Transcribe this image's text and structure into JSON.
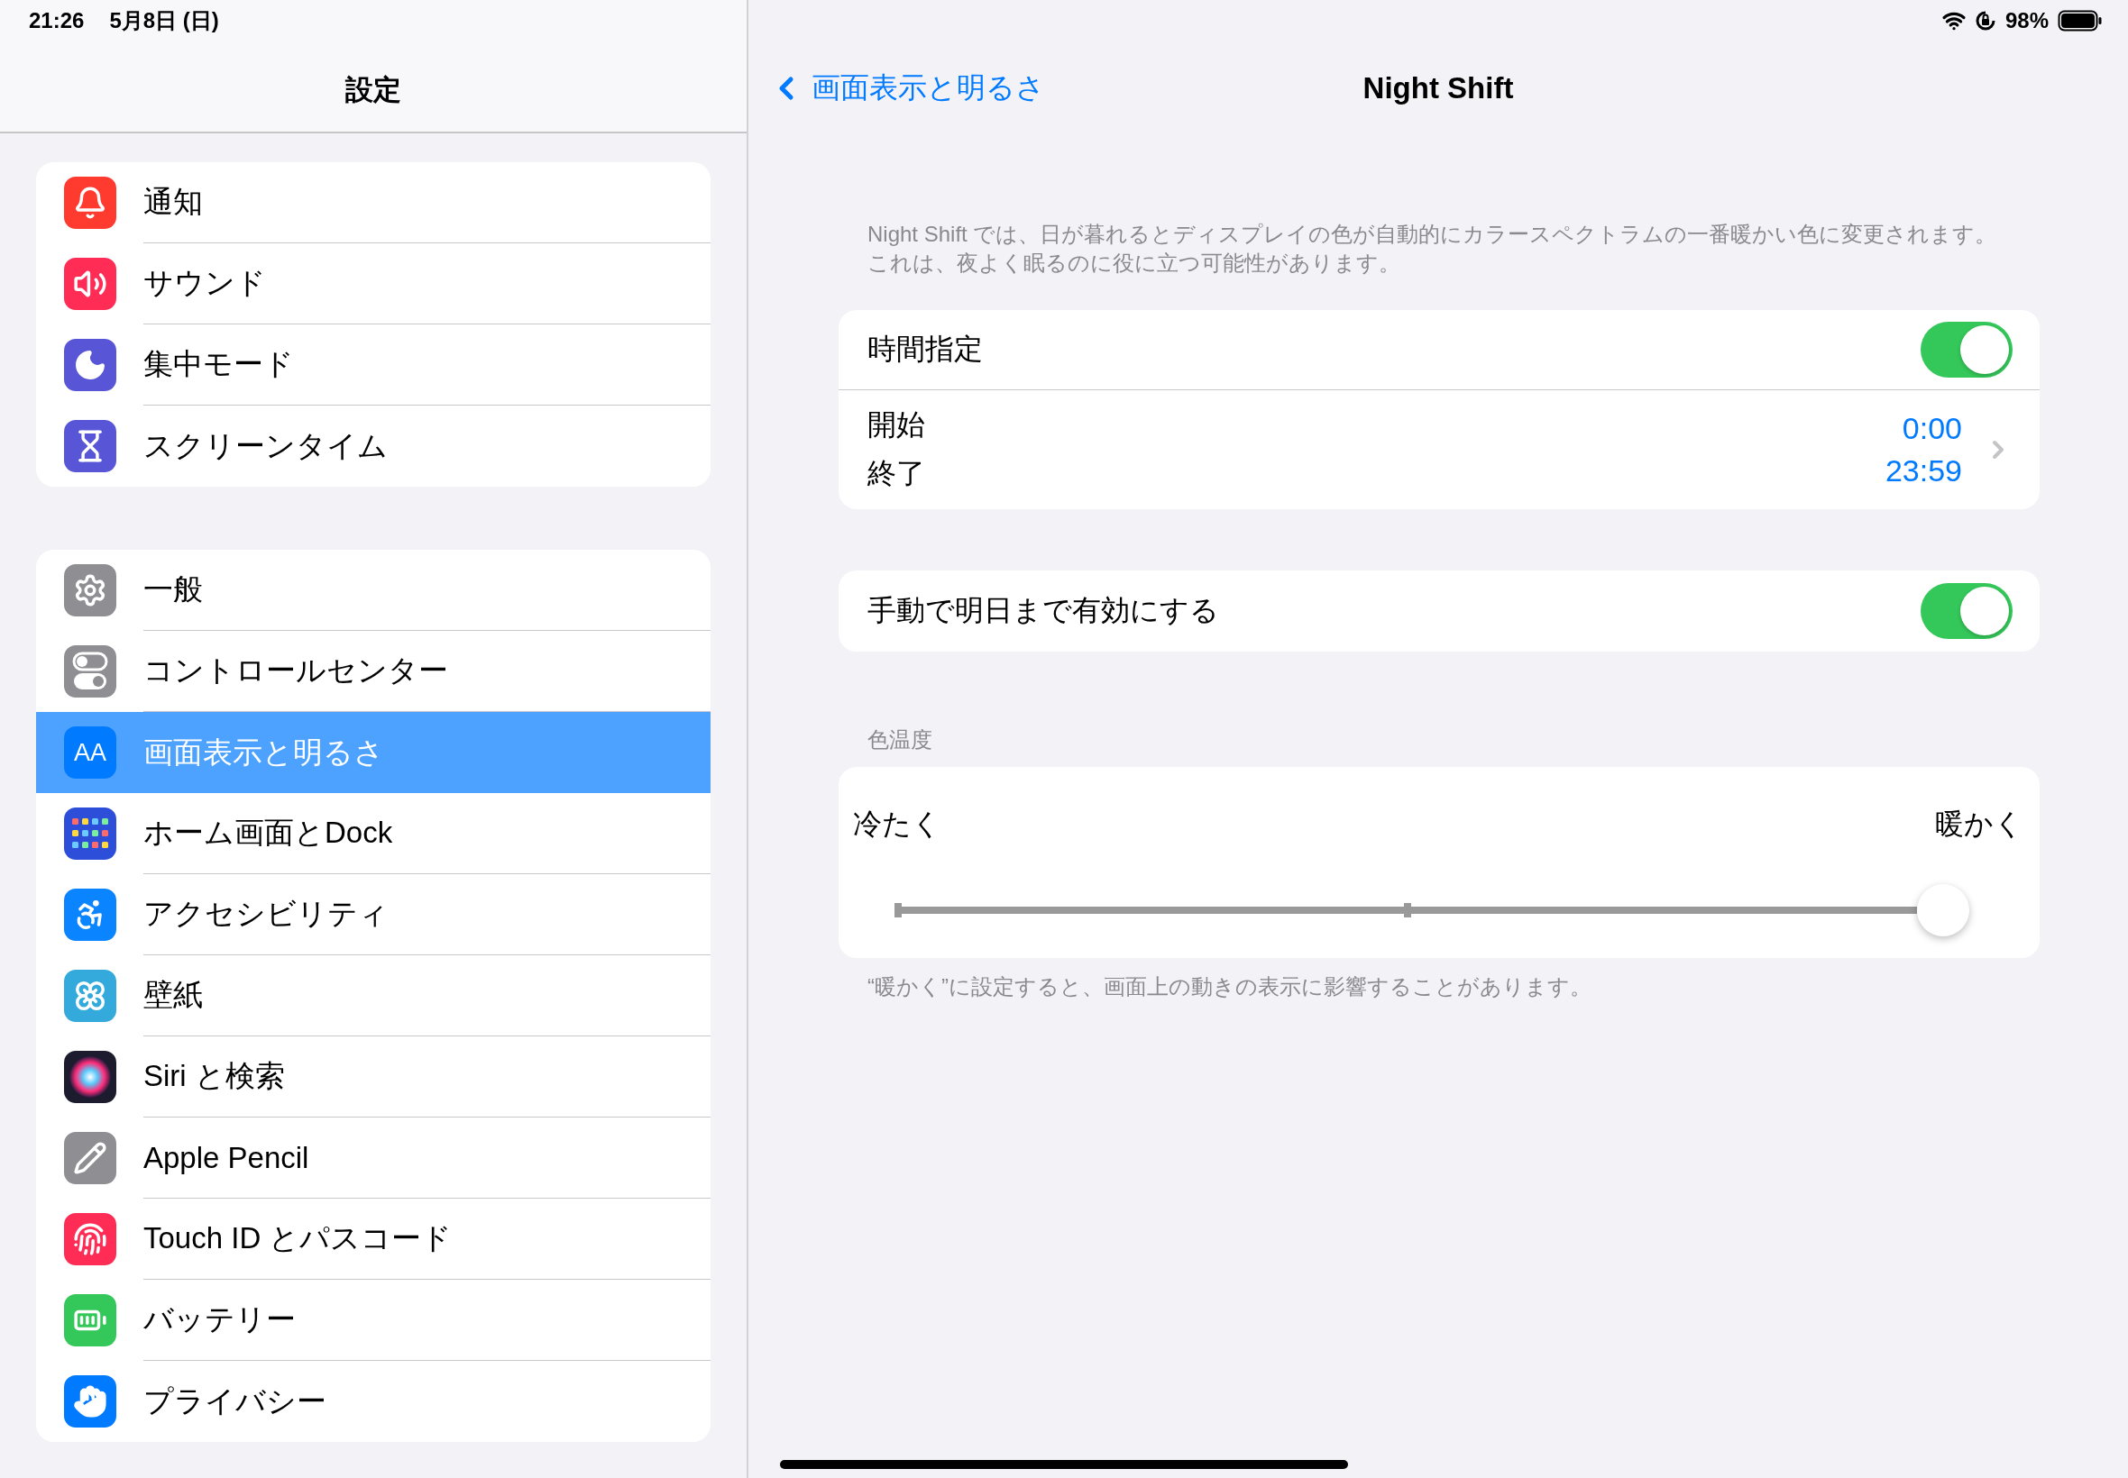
{
  "status_bar": {
    "time": "21:26",
    "date": "5月8日 (日)",
    "battery": "98%"
  },
  "sidebar": {
    "title": "設定",
    "groups": [
      {
        "items": [
          {
            "label": "通知",
            "color": "#ff3b30",
            "selected": false
          },
          {
            "label": "サウンド",
            "color": "#ff2d55",
            "selected": false
          },
          {
            "label": "集中モード",
            "color": "#5856d6",
            "selected": false
          },
          {
            "label": "スクリーンタイム",
            "color": "#5856d6",
            "selected": false
          }
        ]
      },
      {
        "items": [
          {
            "label": "一般",
            "color": "#8e8e93",
            "selected": false
          },
          {
            "label": "コントロールセンター",
            "color": "#8e8e93",
            "selected": false
          },
          {
            "label": "画面表示と明るさ",
            "color": "#007aff",
            "selected": true,
            "icon_label": "AA"
          },
          {
            "label": "ホーム画面とDock",
            "color": "#2c4ed8",
            "selected": false
          },
          {
            "label": "アクセシビリティ",
            "color": "#0a84ff",
            "selected": false
          },
          {
            "label": "壁紙",
            "color": "#34aadc",
            "selected": false
          },
          {
            "label": "Siri と検索",
            "color": "#1c1c2e",
            "selected": false
          },
          {
            "label": "Apple Pencil",
            "color": "#8e8e93",
            "selected": false
          },
          {
            "label": "Touch ID とパスコード",
            "color": "#ff2d55",
            "selected": false
          },
          {
            "label": "バッテリー",
            "color": "#34c759",
            "selected": false
          },
          {
            "label": "プライバシー",
            "color": "#007aff",
            "selected": false
          }
        ]
      }
    ]
  },
  "detail": {
    "back": "画面表示と明るさ",
    "title": "Night Shift",
    "description": [
      "Night Shift では、日が暮れるとディスプレイの色が自動的にカラースペクトラムの一番暖かい色に変更されます。",
      "これは、夜よく眠るのに役に立つ可能性があります。"
    ],
    "schedule": {
      "label": "時間指定",
      "on": true,
      "from_label": "開始",
      "to_label": "終了",
      "from": "0:00",
      "to": "23:59"
    },
    "manual": {
      "label": "手動で明日まで有効にする",
      "on": true
    },
    "temperature": {
      "header": "色温度",
      "min_label": "冷たく",
      "max_label": "暖かく",
      "level": 1.0,
      "footnote": "“暖かく”に設定すると、画面上の動きの表示に影響することがあります。"
    }
  }
}
